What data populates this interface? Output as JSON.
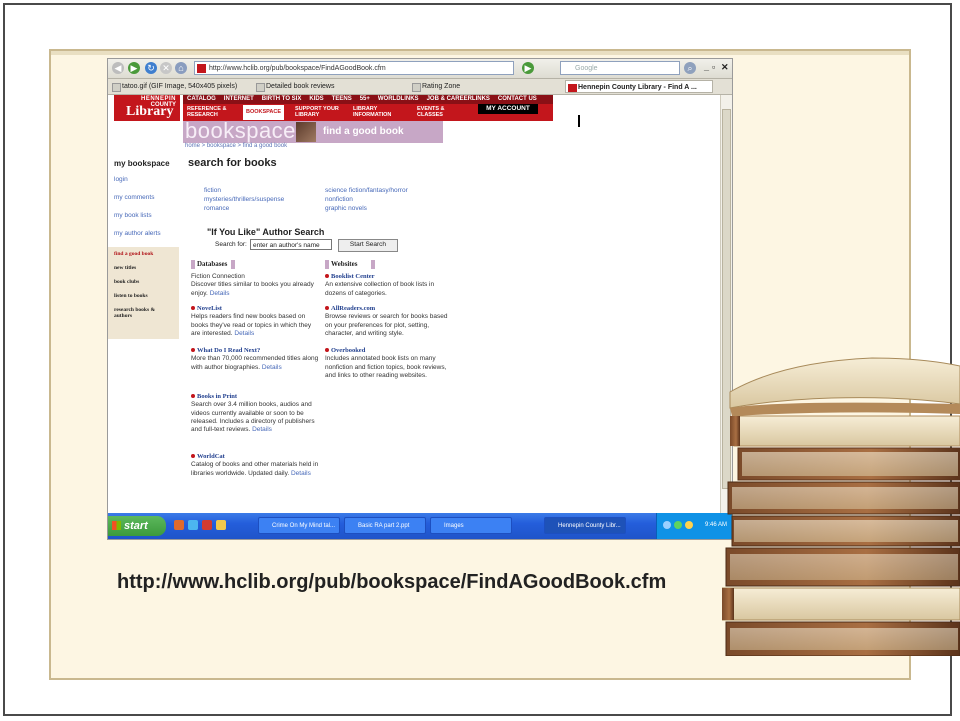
{
  "slide": {
    "caption": "http://www.hclib.org/pub/bookspace/FindAGoodBook.cfm"
  },
  "browser": {
    "url": "http://www.hclib.org/pub/bookspace/FindAGoodBook.cfm",
    "search_placeholder": "Google",
    "tabs": [
      {
        "label": "tatoo.gif (GIF Image, 540x405 pixels)"
      },
      {
        "label": "Detailed book reviews"
      },
      {
        "label": "Rating Zone"
      },
      {
        "label": "Hennepin County Library - Find A ..."
      }
    ]
  },
  "site": {
    "logo": {
      "line1": "HENNEPIN",
      "line2": "COUNTY",
      "line3": "Library"
    },
    "top_nav": [
      "CATALOG",
      "INTERNET",
      "BIRTH TO SIX",
      "KIDS",
      "TEENS",
      "55+",
      "WORLDLINKS",
      "JOB & CAREERLINKS",
      "CONTACT US"
    ],
    "main_nav": [
      "REFERENCE & RESEARCH",
      "BOOKSPACE",
      "SUPPORT YOUR LIBRARY",
      "LIBRARY INFORMATION",
      "EVENTS & CLASSES"
    ],
    "my_account": "MY ACCOUNT",
    "bookspace": "bookspace",
    "find_a_good_book": "find a good book",
    "breadcrumb": "home > bookspace > find a good book"
  },
  "sidebar": {
    "title": "my bookspace",
    "links": [
      "login",
      "my comments",
      "my book lists",
      "my author alerts"
    ],
    "sub": [
      "find a good book",
      "new titles",
      "book clubs",
      "listen to books",
      "research books & authors"
    ]
  },
  "content": {
    "heading": "search for books",
    "categories_left": [
      "fiction",
      "mysteries/thrillers/suspense",
      "romance"
    ],
    "categories_right": [
      "science fiction/fantasy/horror",
      "nonfiction",
      "graphic novels"
    ],
    "if_you_like": "\"If You Like\" Author Search",
    "search_for_label": "Search for:",
    "author_input_value": "enter an author's name",
    "start_search": "Start Search",
    "databases_title": "Databases",
    "websites_title": "Websites",
    "databases": [
      {
        "title": "Fiction Connection",
        "desc": "Discover titles similar to books you already enjoy.",
        "details": "Details"
      },
      {
        "title": "NoveList",
        "desc": "Helps readers find new books based on books they've read or topics in which they are interested.",
        "details": "Details"
      },
      {
        "title": "What Do I Read Next?",
        "desc": "More than 70,000 recommended titles along with author biographies.",
        "details": "Details"
      },
      {
        "title": "Books in Print",
        "desc": "Search over 3.4 million books, audios and videos currently available or soon to be released. Includes a directory of publishers and full-text reviews.",
        "details": "Details"
      },
      {
        "title": "WorldCat",
        "desc": "Catalog of books and other materials held in libraries worldwide. Updated daily.",
        "details": "Details"
      }
    ],
    "websites": [
      {
        "title": "Booklist Center",
        "desc": "An extensive collection of book lists in dozens of categories."
      },
      {
        "title": "AllReaders.com",
        "desc": "Browse reviews or search for books based on your preferences for plot, setting, character, and writing style."
      },
      {
        "title": "Overbooked",
        "desc": "Includes annotated book lists on many nonfiction and fiction topics, book reviews, and links to other reading websites."
      }
    ]
  },
  "taskbar": {
    "start": "start",
    "items": [
      {
        "label": "Crime On My Mind tal..."
      },
      {
        "label": "Basic RA part 2.ppt"
      },
      {
        "label": "Images"
      },
      {
        "label": "Hennepin County Libr..."
      }
    ],
    "time": "9:46 AM"
  }
}
